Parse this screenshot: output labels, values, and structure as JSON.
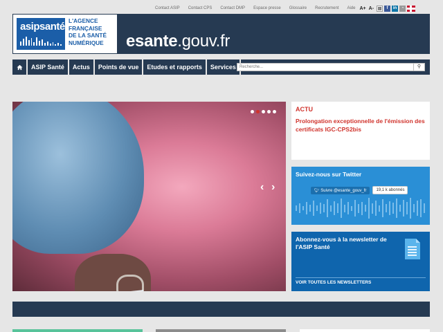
{
  "toplinks": {
    "items": [
      "Contact ASIP",
      "Contact CPS",
      "Contact DMP",
      "Espace presse",
      "Glossaire",
      "Recrutement",
      "Aide"
    ],
    "font_larger": "A+",
    "font_smaller": "A-"
  },
  "header": {
    "logo_brand": "asipsanté",
    "logo_lines": [
      "L'AGENCE",
      "FRANÇAISE",
      "DE LA SANTÉ",
      "NUMÉRIQUE"
    ],
    "site_name_bold": "esante",
    "site_name_rest": ".gouv.fr"
  },
  "nav": {
    "items": [
      "ASIP Santé",
      "Actus",
      "Points de vue",
      "Etudes et rapports",
      "Services"
    ],
    "search_placeholder": "Recherche..."
  },
  "carousel": {
    "slide_count": 5,
    "active_slide": 2
  },
  "actu": {
    "label": "ACTU",
    "title": "Prolongation exceptionnelle de l'émission des certificats IGC-CPS2bis"
  },
  "twitter": {
    "title": "Suivez-nous sur Twitter",
    "follow_label": "Suivre @esante_gouv_fr",
    "followers": "19,1 k abonnés"
  },
  "newsletter": {
    "title": "Abonnez-vous à la newsletter de l'ASIP Santé",
    "link": "VOIR TOUTES LES NEWSLETTERS"
  },
  "colors": {
    "navy": "#263a52",
    "accent_red": "#d0332c",
    "twitter_blue": "#2a8fd6",
    "newsletter_blue": "#0f65ad"
  }
}
